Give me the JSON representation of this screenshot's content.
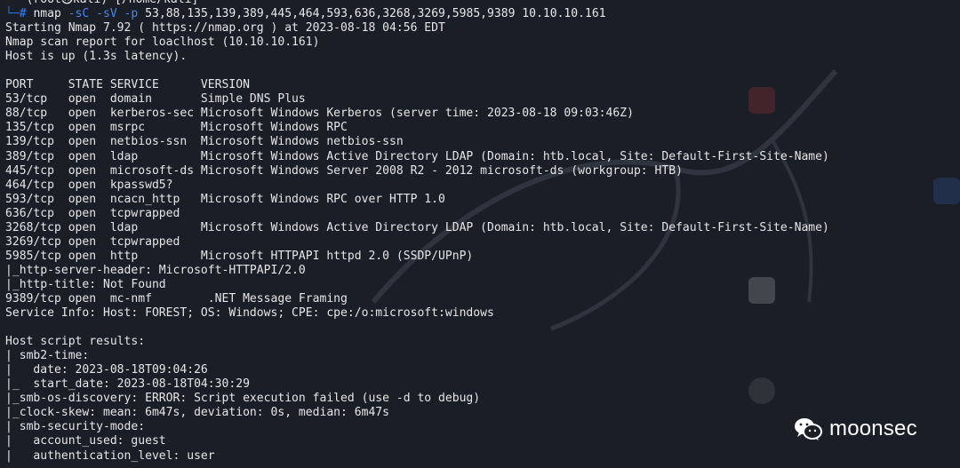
{
  "prompt": {
    "top_line": "└──(root㉿kali)-[/home/kali]",
    "user": "(root㉿kali)",
    "path": "[/home/kali]",
    "hash": "#",
    "command": "nmap",
    "flags": "-sC -sV -p",
    "args": "53,88,135,139,389,445,464,593,636,3268,3269,5985,9389 10.10.10.161"
  },
  "output": {
    "starting": "Starting Nmap 7.92 ( https://nmap.org ) at 2023-08-18 04:56 EDT",
    "report": "Nmap scan report for loaclhost (10.10.10.161)",
    "host_up": "Host is up (1.3s latency).",
    "blank1": "",
    "header": "PORT     STATE SERVICE      VERSION",
    "ports": [
      "53/tcp   open  domain       Simple DNS Plus",
      "88/tcp   open  kerberos-sec Microsoft Windows Kerberos (server time: 2023-08-18 09:03:46Z)",
      "135/tcp  open  msrpc        Microsoft Windows RPC",
      "139/tcp  open  netbios-ssn  Microsoft Windows netbios-ssn",
      "389/tcp  open  ldap         Microsoft Windows Active Directory LDAP (Domain: htb.local, Site: Default-First-Site-Name)",
      "445/tcp  open  microsoft-ds Microsoft Windows Server 2008 R2 - 2012 microsoft-ds (workgroup: HTB)",
      "464/tcp  open  kpasswd5?",
      "593/tcp  open  ncacn_http   Microsoft Windows RPC over HTTP 1.0",
      "636/tcp  open  tcpwrapped",
      "3268/tcp open  ldap         Microsoft Windows Active Directory LDAP (Domain: htb.local, Site: Default-First-Site-Name)",
      "3269/tcp open  tcpwrapped",
      "5985/tcp open  http         Microsoft HTTPAPI httpd 2.0 (SSDP/UPnP)",
      "|_http-server-header: Microsoft-HTTPAPI/2.0",
      "|_http-title: Not Found",
      "9389/tcp open  mc-nmf        .NET Message Framing"
    ],
    "service_info": "Service Info: Host: FOREST; OS: Windows; CPE: cpe:/o:microsoft:windows",
    "blank2": "",
    "host_script": "Host script results:",
    "script_lines": [
      "| smb2-time:",
      "|   date: 2023-08-18T09:04:26",
      "|_  start_date: 2023-08-18T04:30:29",
      "|_smb-os-discovery: ERROR: Script execution failed (use -d to debug)",
      "|_clock-skew: mean: 6m47s, deviation: 0s, median: 6m47s",
      "| smb-security-mode:",
      "|   account_used: guest",
      "|   authentication_level: user"
    ]
  },
  "watermark": {
    "icon": "wechat-icon",
    "text": "moonsec"
  },
  "colors": {
    "background": "#1a1e26",
    "text": "#e6e6e6",
    "prompt_blue": "#2f6fd8",
    "prompt_red": "#ff3b3b",
    "flag_blue": "#4a86e8"
  }
}
